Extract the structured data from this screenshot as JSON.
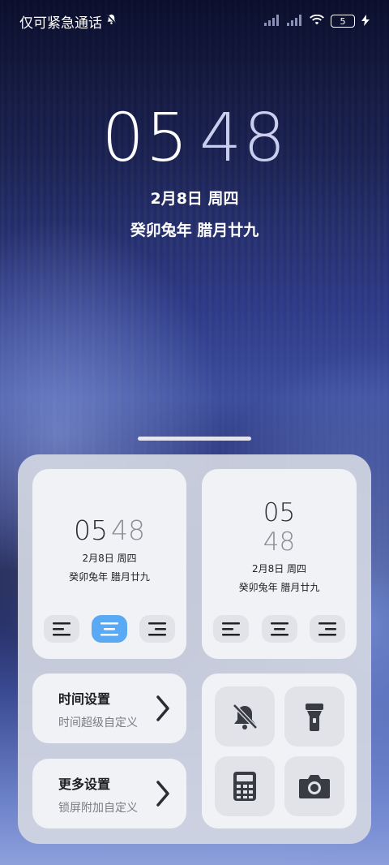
{
  "status_bar": {
    "carrier": "仅可紧急通话",
    "battery": "5",
    "icons": [
      "mute-bell-icon",
      "signal-icon",
      "signal-icon",
      "wifi-icon",
      "battery-icon",
      "charging-icon"
    ]
  },
  "clock": {
    "hours": "05",
    "minutes": "48",
    "date": "2月8日 周四",
    "lunar": "癸卯兔年 腊月廿九"
  },
  "widget_left": {
    "hours": "05",
    "minutes": "48",
    "date": "2月8日 周四",
    "lunar": "癸卯兔年 腊月廿九",
    "selected_alignment": "center"
  },
  "widget_right": {
    "hours": "05",
    "minutes": "48",
    "date": "2月8日 周四",
    "lunar": "癸卯兔年 腊月廿九"
  },
  "time_settings": {
    "title": "时间设置",
    "subtitle": "时间超级自定义"
  },
  "more_settings": {
    "title": "更多设置",
    "subtitle": "锁屏附加自定义"
  },
  "quick_actions": [
    "mute-bell-icon",
    "flashlight-icon",
    "calculator-icon",
    "camera-icon"
  ],
  "colors": {
    "accent": "#5aa9f5",
    "panel": "#d2d6e2",
    "card": "#f1f2f6"
  }
}
